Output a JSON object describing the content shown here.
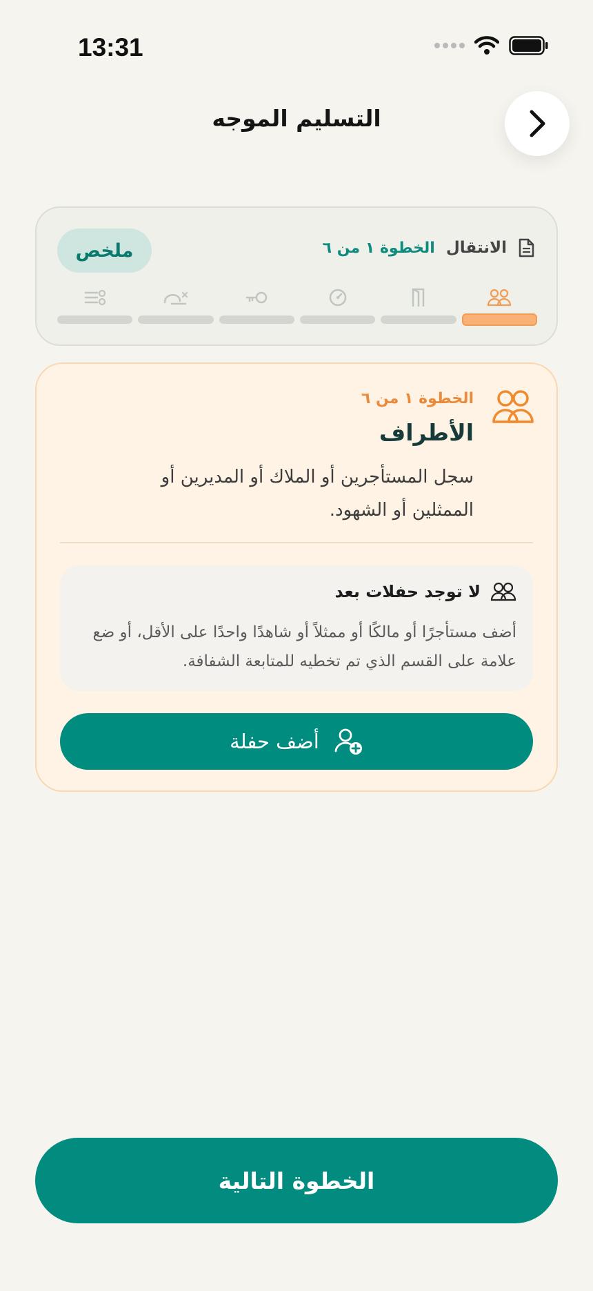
{
  "status_bar": {
    "time": "13:31",
    "icons": [
      "signal-dots-icon",
      "wifi-icon",
      "battery-icon"
    ]
  },
  "header": {
    "title": "التسليم الموجه",
    "back_icon": "chevron-right-icon"
  },
  "progress": {
    "summary_label": "ملخص",
    "section_label": "الانتقال",
    "step_text": "الخطوة ١ من ٦",
    "current_step": 1,
    "total_steps": 6,
    "steps": [
      {
        "icon": "people-icon",
        "active": true
      },
      {
        "icon": "door-icon",
        "active": false
      },
      {
        "icon": "gauge-icon",
        "active": false
      },
      {
        "icon": "key-icon",
        "active": false
      },
      {
        "icon": "damage-icon",
        "active": false
      },
      {
        "icon": "checklist-icon",
        "active": false
      }
    ]
  },
  "step": {
    "counter": "الخطوة ١ من ٦",
    "title": "الأطراف",
    "description": "سجل المستأجرين أو الملاك أو المديرين أو الممثلين أو الشهود."
  },
  "empty_state": {
    "title": "لا توجد حفلات بعد",
    "description": "أضف مستأجرًا أو مالكًا أو ممثلاً أو شاهدًا واحدًا على الأقل، أو ضع علامة على القسم الذي تم تخطيه للمتابعة الشفافة."
  },
  "add_party_label": "أضف حفلة",
  "next_label": "الخطوة التالية",
  "colors": {
    "primary": "#028c80",
    "accent_orange": "#ea8b3c",
    "card_background": "#fef3e5",
    "page_background": "#f5f4ef"
  }
}
